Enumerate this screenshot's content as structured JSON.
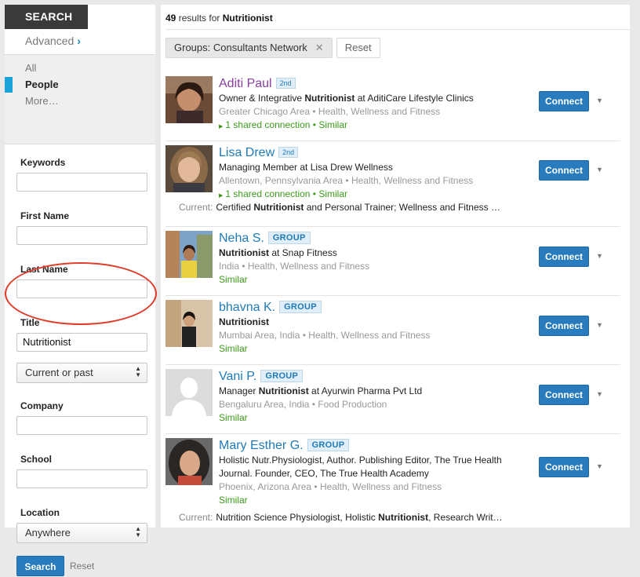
{
  "sidebar": {
    "search_label": "SEARCH",
    "advanced_label": "Advanced",
    "categories": [
      "All",
      "People",
      "More…"
    ],
    "fields": {
      "keywords_label": "Keywords",
      "keywords_value": "",
      "first_name_label": "First Name",
      "first_name_value": "",
      "last_name_label": "Last Name",
      "last_name_value": "",
      "title_label": "Title",
      "title_value": "Nutritionist",
      "title_scope": "Current or past",
      "company_label": "Company",
      "company_value": "",
      "school_label": "School",
      "school_value": "",
      "location_label": "Location",
      "location_value": "Anywhere"
    },
    "search_button": "Search",
    "reset_link": "Reset"
  },
  "main": {
    "result_count": "49",
    "results_for_text": "results for",
    "query": "Nutritionist",
    "filter_chip": "Groups: Consultants Network",
    "filter_reset": "Reset",
    "connect_label": "Connect",
    "results": [
      {
        "name": "Aditi Paul",
        "badge": "2nd",
        "headline_pre": "Owner & Integrative ",
        "headline_bold": "Nutritionist",
        "headline_post": " at AditiCare Lifestyle Clinics",
        "location": "Greater Chicago Area • Health, Wellness and Fitness",
        "shared": "1 shared connection • Similar"
      },
      {
        "name": "Lisa Drew",
        "badge": "2nd",
        "headline": "Managing Member at Lisa Drew Wellness",
        "location": "Allentown, Pennsylvania Area • Health, Wellness and Fitness",
        "shared": "1 shared connection • Similar",
        "current_label": "Current:",
        "current_pre": "Certified ",
        "current_bold": "Nutritionist",
        "current_post": " and Personal Trainer; Wellness and Fitness …"
      },
      {
        "name": "Neha S.",
        "badge": "GROUP",
        "headline_bold": "Nutritionist",
        "headline_post": " at Snap Fitness",
        "location": "India • Health, Wellness and Fitness",
        "similar": "Similar"
      },
      {
        "name": "bhavna K.",
        "badge": "GROUP",
        "headline_bold": "Nutritionist",
        "location": "Mumbai Area, India • Health, Wellness and Fitness",
        "similar": "Similar"
      },
      {
        "name": "Vani P.",
        "badge": "GROUP",
        "headline_pre": "Manager ",
        "headline_bold": "Nutritionist",
        "headline_post": " at Ayurwin Pharma Pvt Ltd",
        "location": "Bengaluru Area, India • Food Production",
        "similar": "Similar"
      },
      {
        "name": "Mary Esther G.",
        "badge": "GROUP",
        "headline_line1": "Holistic Nutr.Physiologist, Author. Publishing Editor, The True Health",
        "headline_line2": "Journal. Founder, CEO, The True Health Academy",
        "location": "Phoenix, Arizona Area • Health, Wellness and Fitness",
        "similar": "Similar",
        "current_label": "Current:",
        "current_pre": "Nutrition Science Physiologist, Holistic ",
        "current_bold": "Nutritionist",
        "current_post": ", Research Writ…"
      }
    ]
  }
}
